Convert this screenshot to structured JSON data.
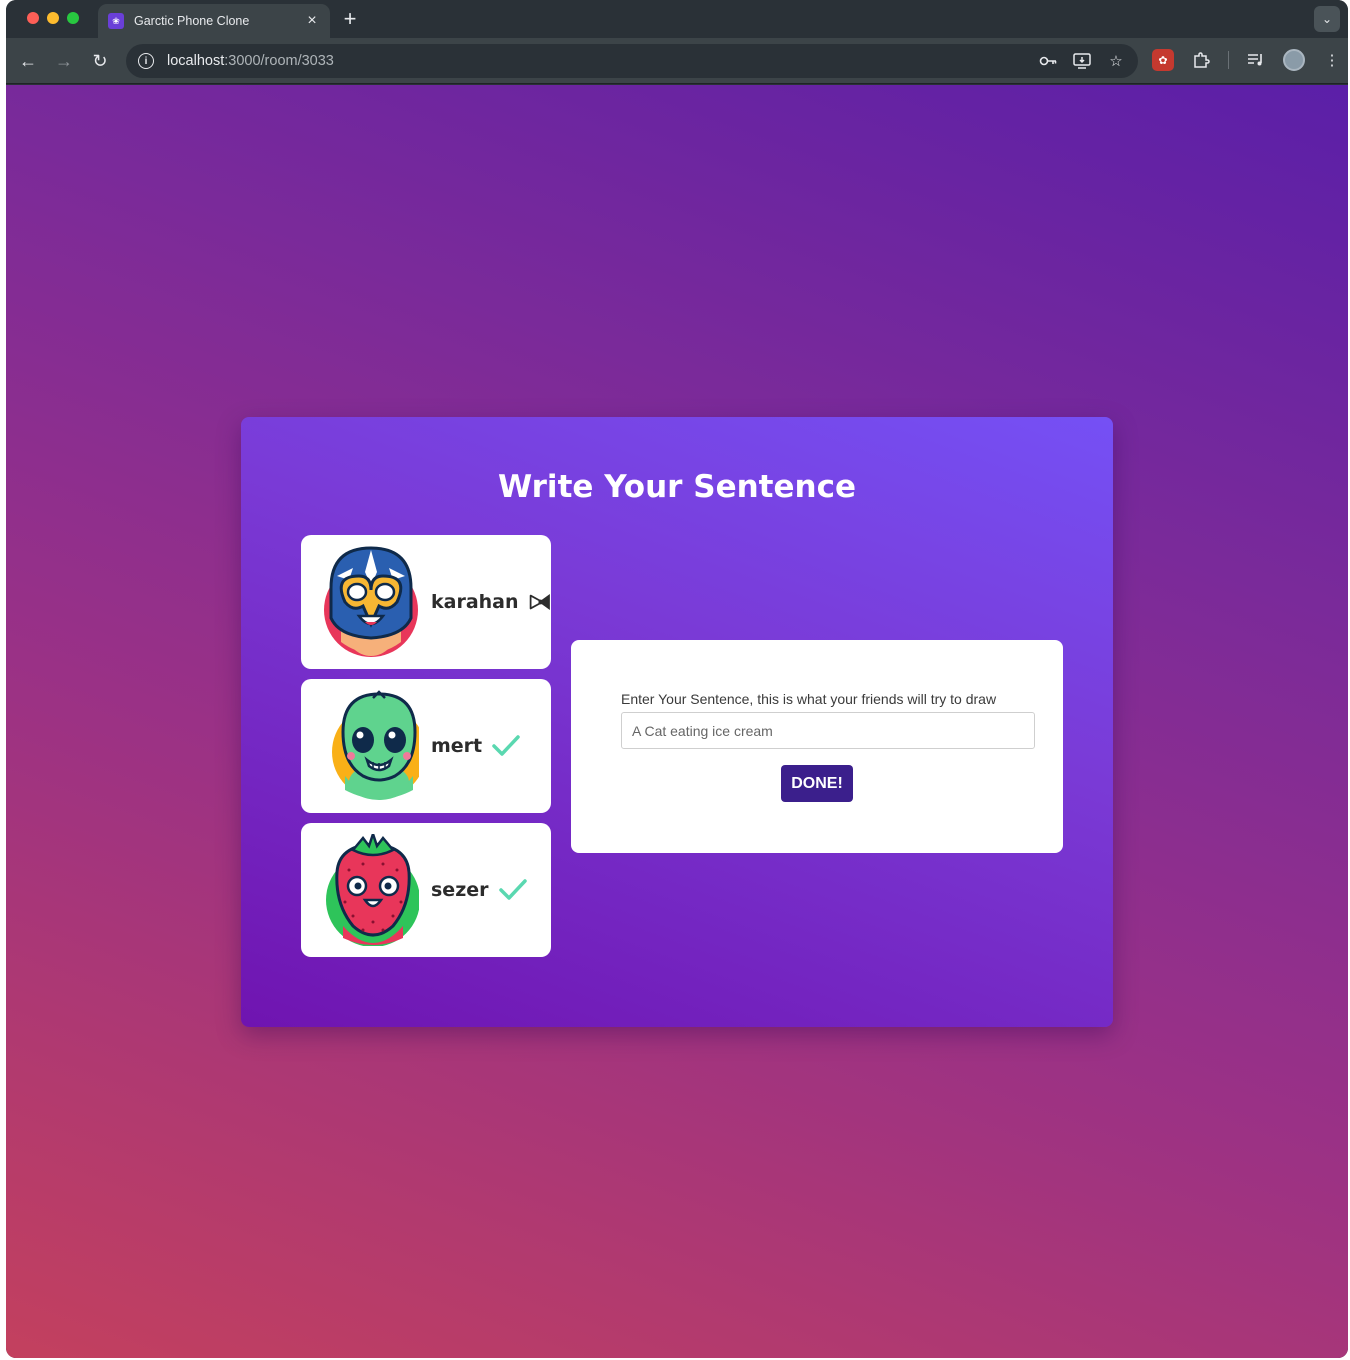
{
  "browser": {
    "tab_title": "Garctic Phone Clone",
    "tab_close": "×",
    "new_tab": "+",
    "url_host": "localhost",
    "url_path": ":3000/room/3033",
    "icons": [
      "back-arrow-icon",
      "forward-arrow-icon",
      "reload-icon",
      "site-info-icon",
      "password-key-icon",
      "install-app-icon",
      "bookmark-star-icon",
      "extension-icon",
      "puzzle-icon",
      "media-queue-icon",
      "profile-avatar-icon",
      "kebab-menu-icon",
      "tab-search-icon"
    ]
  },
  "game": {
    "title": "Write Your Sentence",
    "players": [
      {
        "name": "karahan",
        "avatar": "luchador-mask-avatar",
        "status": "host-bowtie-icon"
      },
      {
        "name": "mert",
        "avatar": "alien-avatar",
        "status": "checkmark-icon"
      },
      {
        "name": "sezer",
        "avatar": "strawberry-avatar",
        "status": "checkmark-icon"
      }
    ],
    "prompt_label": "Enter Your Sentence, this is what your friends will try to draw",
    "input_placeholder": "A Cat eating ice cream",
    "done_label": "DONE!"
  },
  "colors": {
    "card_gradient_start": "#7550f5",
    "card_gradient_end": "#6f14b0",
    "done_button": "#3b1f8c",
    "checkmark": "#5ad8b0"
  }
}
